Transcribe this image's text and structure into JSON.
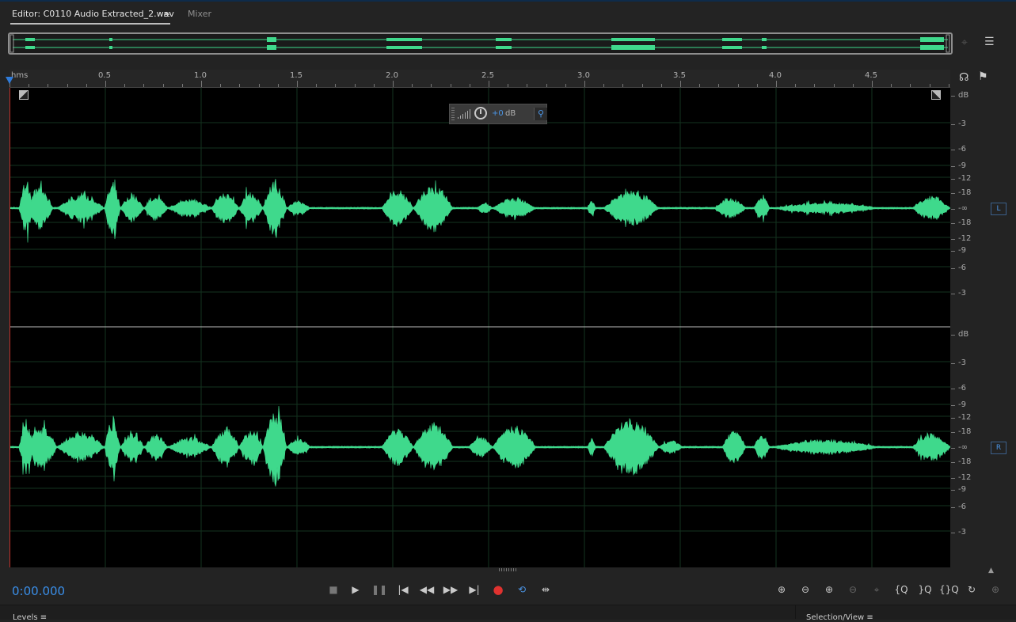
{
  "tabs": {
    "editor_label": "Editor: C0110 Audio Extracted_2.wav",
    "editor_menu_icon": "hamburger-icon",
    "mixer_label": "Mixer"
  },
  "overview": {
    "right_icons": [
      "zoom-to-selection-icon",
      "list-icon"
    ]
  },
  "ruler": {
    "unit": "hms",
    "labels": [
      "0.5",
      "1.0",
      "1.5",
      "2.0",
      "2.5",
      "3.0",
      "3.5",
      "4.0",
      "4.5"
    ],
    "right_icons": [
      "headphones-icon",
      "marker-icon"
    ]
  },
  "hud": {
    "value": "+0",
    "unit": "dB"
  },
  "db_scale": {
    "labels": [
      "dB",
      "-3",
      "-6",
      "-9",
      "-12",
      "-18",
      "-∞",
      "-18",
      "-12",
      "-9",
      "-6",
      "-3"
    ],
    "left_channel": "L",
    "right_channel": "R"
  },
  "timecode": "0:00.000",
  "transport": {
    "buttons": [
      "stop",
      "play",
      "pause",
      "go-to-start",
      "rewind",
      "fast-forward",
      "go-to-end",
      "record",
      "loop",
      "skip-selection"
    ]
  },
  "zoom": {
    "buttons": [
      "zoom-in-amplitude",
      "zoom-out-amplitude",
      "zoom-in-time",
      "zoom-out-time",
      "zoom-out-full",
      "zoom-in-at-in-point",
      "zoom-in-at-out-point",
      "zoom-to-selection",
      "zoom-reset",
      "zoom-all-selected"
    ]
  },
  "panels": {
    "levels": "Levels",
    "selection_view": "Selection/View"
  },
  "colors": {
    "waveform": "#3fd98c",
    "timecode": "#3a8ee8",
    "accent": "#4b95e6",
    "record": "#e0322f"
  }
}
